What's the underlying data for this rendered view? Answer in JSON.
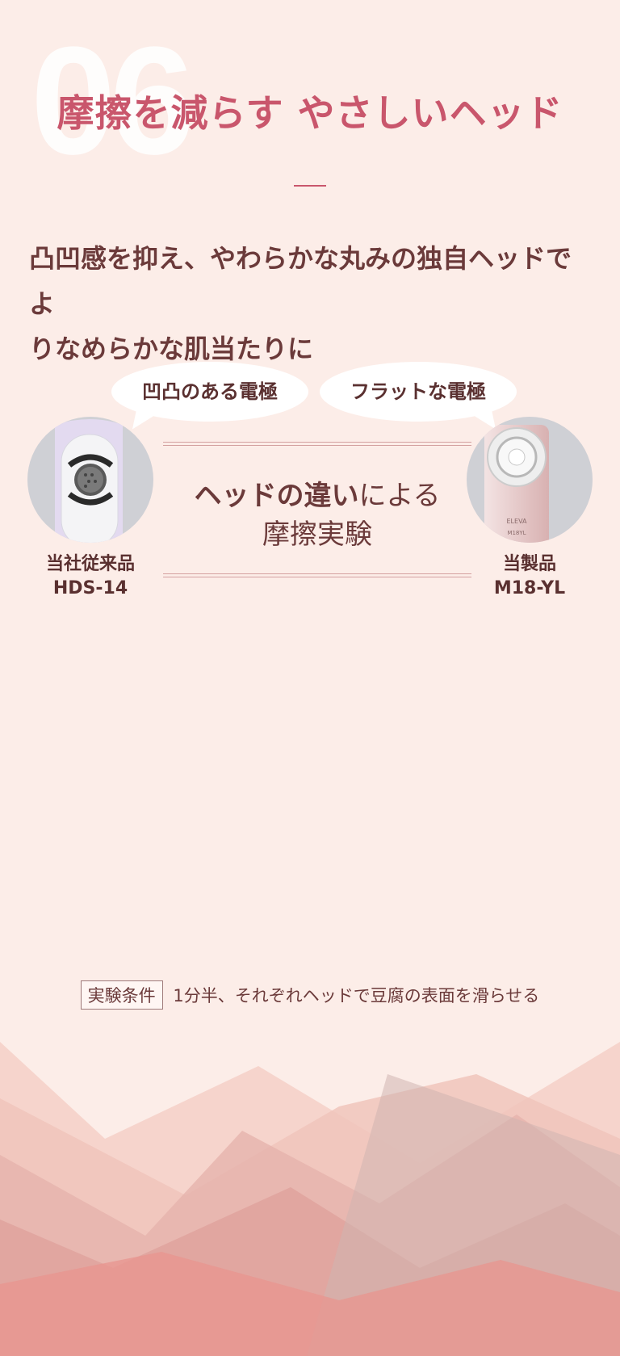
{
  "section": {
    "number": "06",
    "title": "摩擦を減らす やさしいヘッド",
    "lead_line1": "凸凹感を抑え、やわらかな丸みの独自ヘッドでよ",
    "lead_line2": "りなめらかな肌当たりに"
  },
  "comparison": {
    "left_bubble": "凹凸のある電極",
    "right_bubble": "フラットな電極",
    "left_product_label": "当社従来品",
    "left_product_model": "HDS-14",
    "right_product_label": "当製品",
    "right_product_model": "M18-YL",
    "center_title_bold": "ヘッドの違い",
    "center_title_rest": "による",
    "center_title_line2": "摩擦実験",
    "device_print_1": "ELEVA",
    "device_print_2": "M18YL"
  },
  "conditions": {
    "label": "実験条件",
    "text": "1分半、それぞれヘッドで豆腐の表面を滑らせる"
  },
  "colors": {
    "background": "#fcede8",
    "title": "#c9566c",
    "text": "#6b3a3a"
  }
}
